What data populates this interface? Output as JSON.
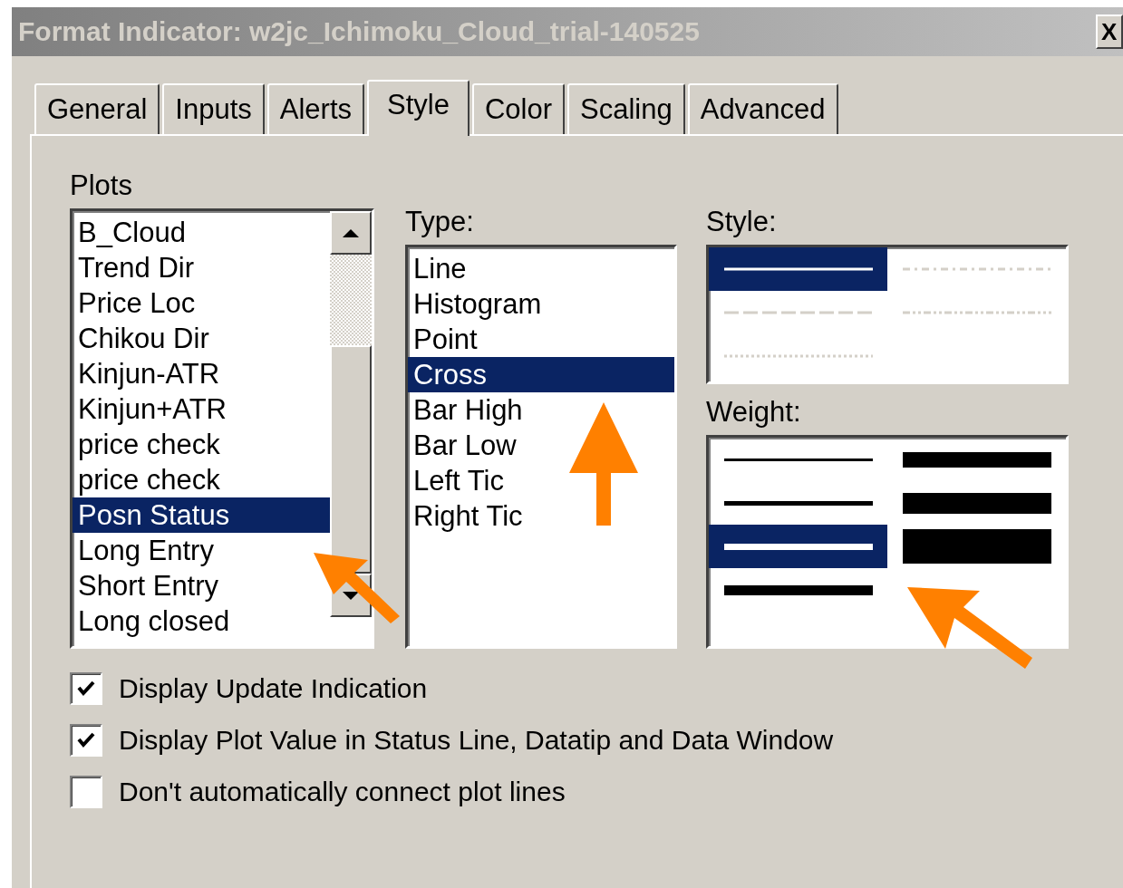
{
  "window": {
    "title": "Format Indicator: w2jc_Ichimoku_Cloud_trial-140525",
    "close": "X"
  },
  "tabs": [
    {
      "label": "General",
      "selected": false
    },
    {
      "label": "Inputs",
      "selected": false
    },
    {
      "label": "Alerts",
      "selected": false
    },
    {
      "label": "Style",
      "selected": true
    },
    {
      "label": "Color",
      "selected": false
    },
    {
      "label": "Scaling",
      "selected": false
    },
    {
      "label": "Advanced",
      "selected": false
    }
  ],
  "plots": {
    "label": "Plots",
    "items": [
      {
        "label": "B_Cloud",
        "selected": false
      },
      {
        "label": "Trend Dir",
        "selected": false
      },
      {
        "label": "Price Loc",
        "selected": false
      },
      {
        "label": "Chikou Dir",
        "selected": false
      },
      {
        "label": "Kinjun-ATR",
        "selected": false
      },
      {
        "label": "Kinjun+ATR",
        "selected": false
      },
      {
        "label": "price check",
        "selected": false
      },
      {
        "label": "price check",
        "selected": false
      },
      {
        "label": "Posn Status",
        "selected": true
      },
      {
        "label": "Long Entry",
        "selected": false
      },
      {
        "label": "Short Entry",
        "selected": false
      },
      {
        "label": "Long closed",
        "selected": false
      }
    ]
  },
  "type": {
    "label": "Type:",
    "items": [
      {
        "label": "Line",
        "selected": false
      },
      {
        "label": "Histogram",
        "selected": false
      },
      {
        "label": "Point",
        "selected": false
      },
      {
        "label": "Cross",
        "selected": true
      },
      {
        "label": "Bar High",
        "selected": false
      },
      {
        "label": "Bar Low",
        "selected": false
      },
      {
        "label": "Left Tic",
        "selected": false
      },
      {
        "label": "Right Tic",
        "selected": false
      }
    ]
  },
  "style": {
    "label": "Style:",
    "items": [
      {
        "kind": "solid",
        "selected": true
      },
      {
        "kind": "dashdot",
        "selected": false
      },
      {
        "kind": "dashed",
        "selected": false
      },
      {
        "kind": "dashdotdot",
        "selected": false
      },
      {
        "kind": "dotted",
        "selected": false
      }
    ]
  },
  "weight": {
    "label": "Weight:",
    "items": [
      {
        "selected": false
      },
      {
        "selected": false
      },
      {
        "selected": true
      },
      {
        "selected": false
      },
      {
        "selected": false
      },
      {
        "selected": false
      },
      {
        "selected": false
      }
    ]
  },
  "options": [
    {
      "label": "Display Update Indication",
      "checked": true
    },
    {
      "label": "Display Plot Value in Status Line, Datatip and Data Window",
      "checked": true
    },
    {
      "label": "Don't automatically connect plot lines",
      "checked": false
    }
  ]
}
